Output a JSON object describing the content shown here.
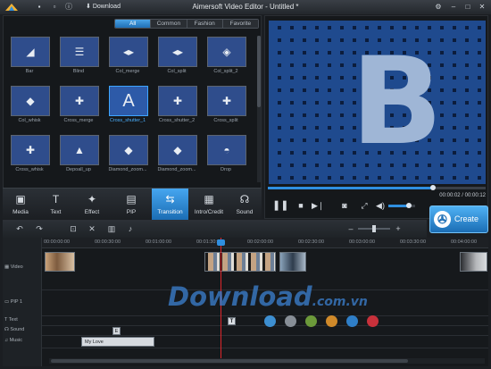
{
  "app": {
    "title": "Aimersoft Video Editor - Untitled *",
    "download_label": "Download"
  },
  "library": {
    "tabs": [
      {
        "label": "All",
        "active": true
      },
      {
        "label": "Common",
        "active": false
      },
      {
        "label": "Fashion",
        "active": false
      },
      {
        "label": "Favorite",
        "active": false
      }
    ],
    "tiles": [
      {
        "label": "Bar",
        "icon": "stairs-icon",
        "selected": false
      },
      {
        "label": "Blind",
        "icon": "blind-icon",
        "selected": false
      },
      {
        "label": "Col_merge",
        "icon": "col-merge-icon",
        "selected": false
      },
      {
        "label": "Col_split",
        "icon": "col-split-icon",
        "selected": false
      },
      {
        "label": "Col_split_2",
        "icon": "col-split-2-icon",
        "selected": false
      },
      {
        "label": "Col_whisk",
        "icon": "col-whisk-icon",
        "selected": false
      },
      {
        "label": "Cross_merge",
        "icon": "cross-merge-icon",
        "selected": false
      },
      {
        "label": "Cross_shutter_1",
        "icon": "letter-a-icon",
        "selected": true
      },
      {
        "label": "Cross_shutter_2",
        "icon": "cross-shutter-icon",
        "selected": false
      },
      {
        "label": "Cross_split",
        "icon": "cross-split-icon",
        "selected": false
      },
      {
        "label": "Cross_whisk",
        "icon": "cross-whisk-icon",
        "selected": false
      },
      {
        "label": "Depoall_up",
        "icon": "arrow-up-icon",
        "selected": false
      },
      {
        "label": "Diamond_zoom...",
        "icon": "diamond-zoom-in-icon",
        "selected": false
      },
      {
        "label": "Diamond_zoom...",
        "icon": "diamond-zoom-out-icon",
        "selected": false
      },
      {
        "label": "Drop",
        "icon": "drop-icon",
        "selected": false
      }
    ],
    "categories": [
      {
        "label": "Media",
        "icon": "media-icon",
        "glyph": "▣",
        "active": false
      },
      {
        "label": "Text",
        "icon": "text-icon",
        "glyph": "T",
        "active": false
      },
      {
        "label": "Effect",
        "icon": "effect-icon",
        "glyph": "✦",
        "active": false
      },
      {
        "label": "PIP",
        "icon": "pip-icon",
        "glyph": "▤",
        "active": false
      },
      {
        "label": "Transition",
        "icon": "transition-icon",
        "glyph": "⇆",
        "active": true
      },
      {
        "label": "Intro/Credit",
        "icon": "intro-credit-icon",
        "glyph": "▦",
        "active": false
      },
      {
        "label": "Sound",
        "icon": "headphones-icon",
        "glyph": "☊",
        "active": false
      }
    ]
  },
  "preview": {
    "letter": "B",
    "time": "00:00:02 / 00:00:12",
    "progress": 0.76,
    "volume": 0.75
  },
  "create": {
    "label": "Create"
  },
  "timeline": {
    "ticks": [
      "00:00:00:00",
      "00:00:30:00",
      "00:01:00:00",
      "00:01:30:00",
      "00:02:00:00",
      "00:02:30:00",
      "00:03:00:00",
      "00:03:30:00",
      "00:04:00:00"
    ],
    "tracks": [
      {
        "label": "Video",
        "icon": "video-track-icon"
      },
      {
        "label": "PIP 1",
        "icon": "pip-track-icon"
      },
      {
        "label": "Text",
        "icon": "text-track-icon"
      },
      {
        "label": "Sound",
        "icon": "sound-track-icon"
      },
      {
        "label": "Music",
        "icon": "music-track-icon"
      }
    ],
    "music_clip": "My Love",
    "sound_clip": "E",
    "text_clip": "T",
    "dot_colors": [
      "#3d8fd1",
      "#888f97",
      "#6c9a3a",
      "#d08a2a",
      "#2f7fc8",
      "#c8313b"
    ]
  },
  "watermark": {
    "main": "Download",
    "suffix": ".com.vn"
  }
}
